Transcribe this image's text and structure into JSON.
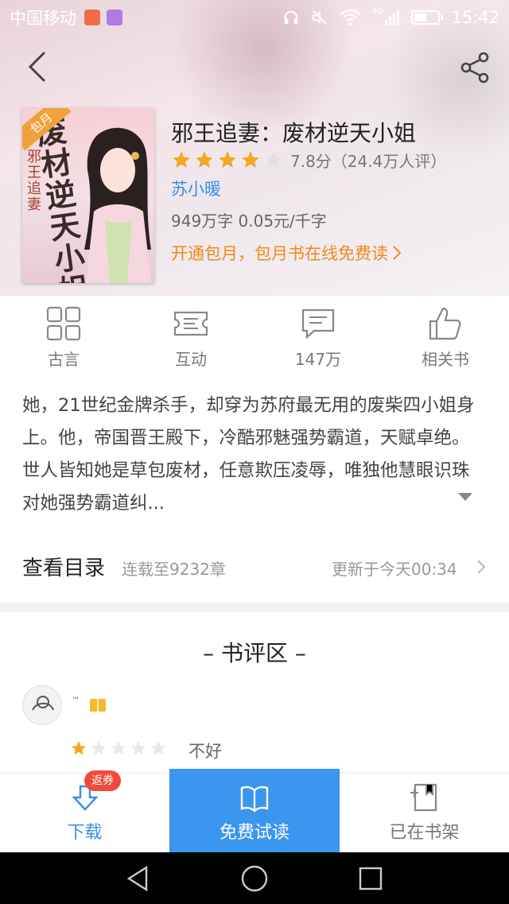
{
  "status_bar": {
    "carrier": "中国移动",
    "network": "4G",
    "time": "15:42"
  },
  "book": {
    "title": "邪王追妻：废材逆天小姐",
    "rating_stars": 4,
    "rating_text": "7.8分（24.4万人评）",
    "author": "苏小暖",
    "meta": "949万字  0.05元/千字",
    "promo": "开通包月，包月书在线免费读",
    "cover_badge": "包月",
    "cover_title": "废材逆天小姐",
    "cover_subtitle": "邪王追妻"
  },
  "features": [
    {
      "label": "古言",
      "icon": "grid-icon"
    },
    {
      "label": "互动",
      "icon": "ticket-icon"
    },
    {
      "label": "147万",
      "icon": "comment-icon"
    },
    {
      "label": "相关书",
      "icon": "thumbs-up-icon"
    }
  ],
  "description": "她，21世纪金牌杀手，却穿为苏府最无用的废柴四小姐身上。他，帝国晋王殿下，冷酷邪魅强势霸道，天赋卓绝。世人皆知她是草包废材，任意欺压凌辱，唯独他慧眼识珠对她强势霸道纠...",
  "toc": {
    "label": "查看目录",
    "chapters": "连载至9232章",
    "updated": "更新于今天00:34"
  },
  "reviews": {
    "section_title": "– 书评区 –",
    "items": [
      {
        "user_mark": "™",
        "stars": 1,
        "text": "不好"
      }
    ]
  },
  "bottom_bar": {
    "download": "下载",
    "coupon": "返券",
    "read": "免费试读",
    "shelf": "已在书架"
  },
  "colors": {
    "accent": "#3a96ee",
    "promo": "#f08a1c",
    "star": "#f5a623",
    "coupon": "#f04b3a"
  }
}
